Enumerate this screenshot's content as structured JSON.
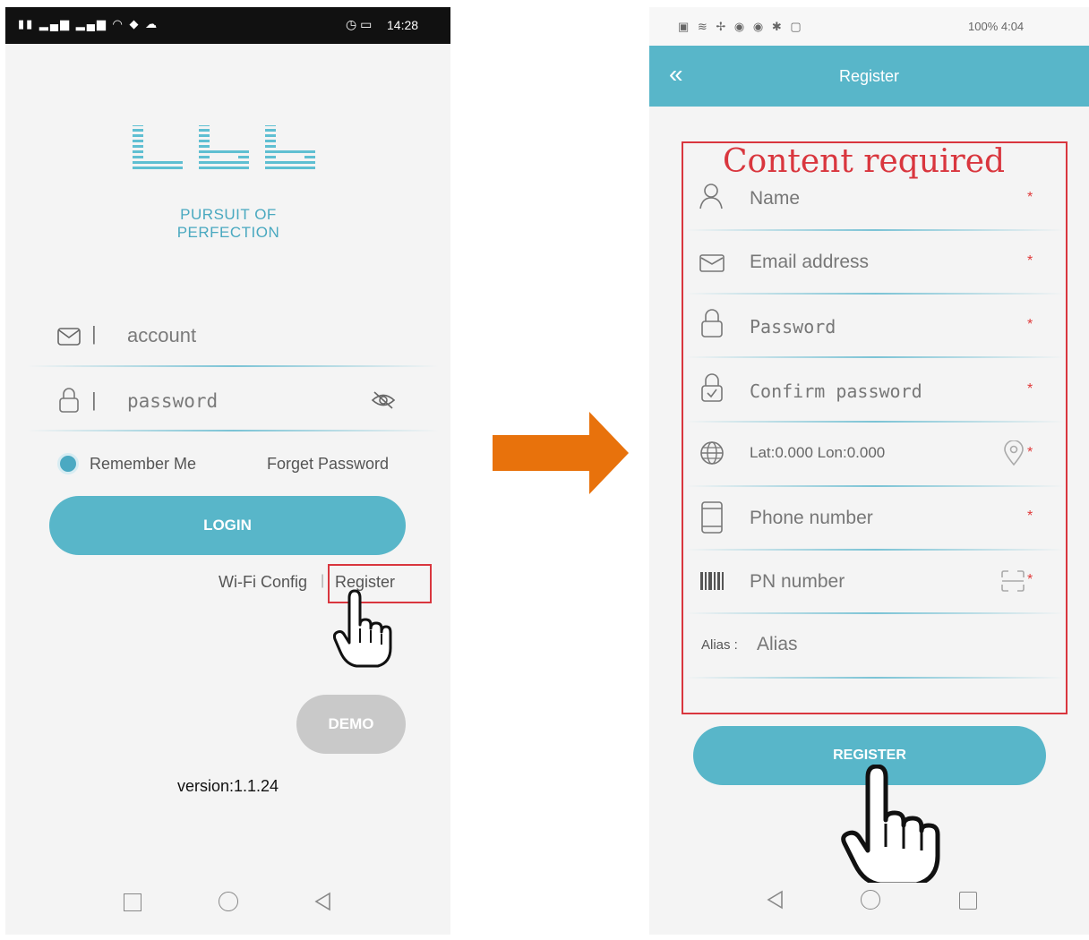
{
  "left_screen": {
    "status": {
      "time": "14:28"
    },
    "logo": {
      "text": "ʟʙʙ",
      "tagline": "PURSUIT OF PERFECTION"
    },
    "account": {
      "placeholder": "account"
    },
    "password": {
      "placeholder": "password"
    },
    "remember": "Remember Me",
    "forgot": "Forget Password",
    "login": "LOGIN",
    "wifi": "Wi-Fi Config",
    "separator": "|",
    "register": "Register",
    "demo": "DEMO",
    "version": "version:1.1.24"
  },
  "right_screen": {
    "status": {
      "right": "100% 4:04"
    },
    "title": "Register",
    "back": "«",
    "annotation": "Content required",
    "fields": {
      "name": "Name",
      "email": "Email address",
      "password": "Password",
      "confirm": "Confirm password",
      "location": "Lat:0.000 Lon:0.000",
      "phone": "Phone number",
      "pn": "PN number",
      "alias_label": "Alias :",
      "alias_placeholder": "Alias"
    },
    "required_mark": "*",
    "register_button": "REGISTER"
  },
  "colors": {
    "accent": "#58b6c9",
    "highlight": "#d9363e",
    "arrow": "#e8720c",
    "demo": "#c9c9c9"
  }
}
